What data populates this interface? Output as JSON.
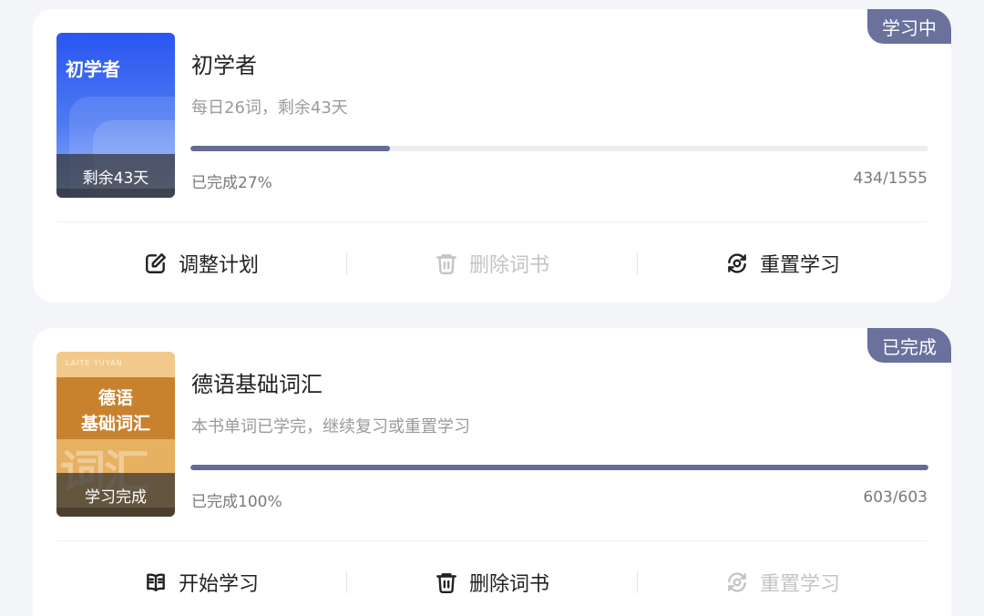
{
  "books": [
    {
      "badge": "学习中",
      "cover": {
        "title": "初学者",
        "footer": "剩余43天"
      },
      "title": "初学者",
      "subtitle": "每日26词，剩余43天",
      "progress_fraction": 0.27,
      "progress_text": "已完成27%",
      "count_text": "434/1555",
      "actions": [
        {
          "label": "调整计划",
          "icon": "edit-icon",
          "enabled": true
        },
        {
          "label": "删除词书",
          "icon": "trash-icon",
          "enabled": false
        },
        {
          "label": "重置学习",
          "icon": "reset-icon",
          "enabled": true
        }
      ]
    },
    {
      "badge": "已完成",
      "cover": {
        "brand": "LAITE YUYAN",
        "title_line1": "德语",
        "title_line2": "基础词汇",
        "watermark": "词汇",
        "footer": "学习完成"
      },
      "title": "德语基础词汇",
      "subtitle": "本书单词已学完，继续复习或重置学习",
      "progress_fraction": 1.0,
      "progress_text": "已完成100%",
      "count_text": "603/603",
      "actions": [
        {
          "label": "开始学习",
          "icon": "book-open-icon",
          "enabled": true
        },
        {
          "label": "删除词书",
          "icon": "trash-icon",
          "enabled": true
        },
        {
          "label": "重置学习",
          "icon": "reset-icon",
          "enabled": false
        }
      ]
    }
  ],
  "colors": {
    "accent": "#646b96",
    "badge_bg": "#69719c",
    "disabled_text": "#c4c4c4"
  }
}
